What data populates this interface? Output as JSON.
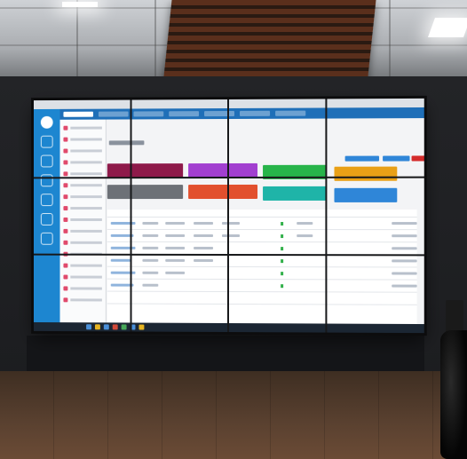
{
  "scene": {
    "colors": {
      "tile_maroon": "#8e1a4a",
      "tile_purple": "#a23fd0",
      "tile_green": "#27b44a",
      "tile_orange": "#e9a016",
      "tile_gray": "#6d7177",
      "tile_red": "#e2502e",
      "tile_teal": "#1fb4a8",
      "tile_blue": "#2f86d8",
      "header_blue": "#1f6fb8",
      "rail_blue": "#1d86d0"
    }
  }
}
